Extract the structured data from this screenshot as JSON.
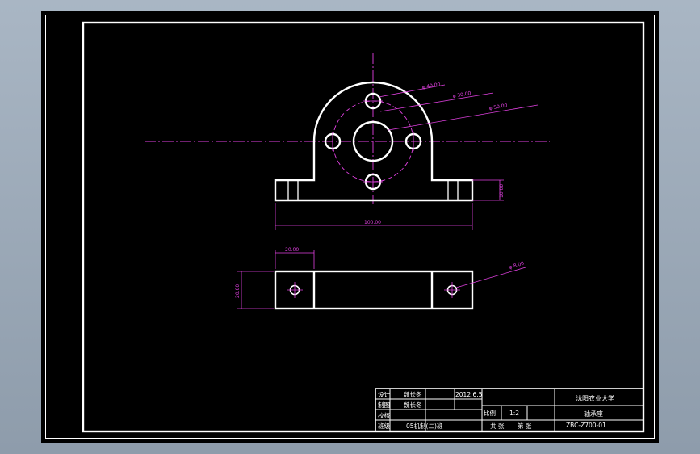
{
  "colors": {
    "background": "#8e9cab",
    "paper": "#000000",
    "outline": "#ffffff",
    "dimension": "#e040e0"
  },
  "dimensions": {
    "hole_small_dia": "φ 40.00",
    "hole_bolt_circle": "φ 30.00",
    "hole_center_dia": "φ 50.00",
    "base_height": "10.00",
    "base_width": "100.00",
    "slot_width": "20.00",
    "plan_height": "20.00",
    "plan_hole_dia": "φ 8.00"
  },
  "title_block": {
    "university": "沈阳农业大学",
    "part_name": "轴承座",
    "drawing_number": "ZBC-Z700-01",
    "scale_label": "比例",
    "scale_value": "1:2",
    "sheets_total": "共 张",
    "sheet_no": "第 张",
    "rows": [
      {
        "role": "设计",
        "name": "魏长冬",
        "date": "2012.6.5"
      },
      {
        "role": "制图",
        "name": "魏长冬",
        "date": ""
      },
      {
        "role": "校核",
        "name": "",
        "date": ""
      },
      {
        "role": "班级",
        "name": "05机制(二)班",
        "date": ""
      }
    ]
  }
}
